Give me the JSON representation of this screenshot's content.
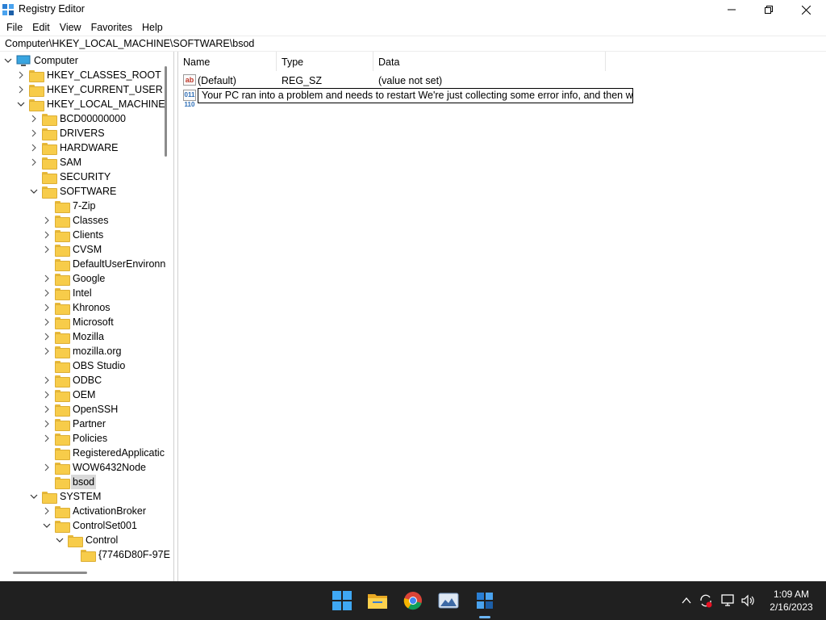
{
  "window": {
    "title": "Registry Editor",
    "minimize_icon": "minimize-icon",
    "maximize_icon": "restore-icon",
    "close_icon": "close-icon"
  },
  "menu": {
    "items": [
      "File",
      "Edit",
      "View",
      "Favorites",
      "Help"
    ]
  },
  "address": {
    "path": "Computer\\HKEY_LOCAL_MACHINE\\SOFTWARE\\bsod"
  },
  "tree": {
    "items": [
      {
        "label": "Computer",
        "level": 0,
        "expander": "expanded",
        "icon": "computer-icon"
      },
      {
        "label": "HKEY_CLASSES_ROOT",
        "level": 1,
        "expander": "collapsed"
      },
      {
        "label": "HKEY_CURRENT_USER",
        "level": 1,
        "expander": "collapsed"
      },
      {
        "label": "HKEY_LOCAL_MACHINE",
        "level": 1,
        "expander": "expanded"
      },
      {
        "label": "BCD00000000",
        "level": 2,
        "expander": "collapsed"
      },
      {
        "label": "DRIVERS",
        "level": 2,
        "expander": "collapsed"
      },
      {
        "label": "HARDWARE",
        "level": 2,
        "expander": "collapsed"
      },
      {
        "label": "SAM",
        "level": 2,
        "expander": "collapsed"
      },
      {
        "label": "SECURITY",
        "level": 2,
        "expander": "none"
      },
      {
        "label": "SOFTWARE",
        "level": 2,
        "expander": "expanded"
      },
      {
        "label": "7-Zip",
        "level": 3,
        "expander": "none"
      },
      {
        "label": "Classes",
        "level": 3,
        "expander": "collapsed"
      },
      {
        "label": "Clients",
        "level": 3,
        "expander": "collapsed"
      },
      {
        "label": "CVSM",
        "level": 3,
        "expander": "collapsed"
      },
      {
        "label": "DefaultUserEnvironn",
        "level": 3,
        "expander": "none"
      },
      {
        "label": "Google",
        "level": 3,
        "expander": "collapsed"
      },
      {
        "label": "Intel",
        "level": 3,
        "expander": "collapsed"
      },
      {
        "label": "Khronos",
        "level": 3,
        "expander": "collapsed"
      },
      {
        "label": "Microsoft",
        "level": 3,
        "expander": "collapsed"
      },
      {
        "label": "Mozilla",
        "level": 3,
        "expander": "collapsed"
      },
      {
        "label": "mozilla.org",
        "level": 3,
        "expander": "collapsed"
      },
      {
        "label": "OBS Studio",
        "level": 3,
        "expander": "none"
      },
      {
        "label": "ODBC",
        "level": 3,
        "expander": "collapsed"
      },
      {
        "label": "OEM",
        "level": 3,
        "expander": "collapsed"
      },
      {
        "label": "OpenSSH",
        "level": 3,
        "expander": "collapsed"
      },
      {
        "label": "Partner",
        "level": 3,
        "expander": "collapsed"
      },
      {
        "label": "Policies",
        "level": 3,
        "expander": "collapsed"
      },
      {
        "label": "RegisteredApplicatic",
        "level": 3,
        "expander": "none"
      },
      {
        "label": "WOW6432Node",
        "level": 3,
        "expander": "collapsed"
      },
      {
        "label": "bsod",
        "level": 3,
        "expander": "none",
        "selected": true
      },
      {
        "label": "SYSTEM",
        "level": 2,
        "expander": "expanded"
      },
      {
        "label": "ActivationBroker",
        "level": 3,
        "expander": "collapsed"
      },
      {
        "label": "ControlSet001",
        "level": 3,
        "expander": "expanded"
      },
      {
        "label": "Control",
        "level": 4,
        "expander": "expanded"
      },
      {
        "label": "{7746D80F-97E",
        "level": 5,
        "expander": "none"
      }
    ]
  },
  "list": {
    "columns": [
      "Name",
      "Type",
      "Data"
    ],
    "rows": [
      {
        "icon": "string-value-icon",
        "icon_glyph": "ab",
        "name": "(Default)",
        "type": "REG_SZ",
        "data": "(value not set)"
      }
    ],
    "editing_row": {
      "icon": "binary-value-icon",
      "icon_glyph": "011 110",
      "value": "Your PC ran  into a problem and needs to restart We're just collecting some error info, and then we'"
    }
  },
  "taskbar": {
    "apps": [
      {
        "name": "start-button",
        "icon": "windows-logo-icon"
      },
      {
        "name": "file-explorer-button",
        "icon": "folder-icon"
      },
      {
        "name": "chrome-button",
        "icon": "chrome-icon"
      },
      {
        "name": "photos-button",
        "icon": "photos-icon"
      },
      {
        "name": "registry-editor-button",
        "icon": "regedit-icon",
        "active": true
      }
    ],
    "tray_icons": [
      "chevron-up-icon",
      "sync-icon",
      "network-icon",
      "volume-icon"
    ],
    "time": "1:09 AM",
    "date": "2/16/2023"
  },
  "colors": {
    "taskbar_bg": "#202020",
    "selection_bg": "#d9d9d9",
    "folder": "#f7cc4a",
    "accent": "#6cb6f5"
  }
}
